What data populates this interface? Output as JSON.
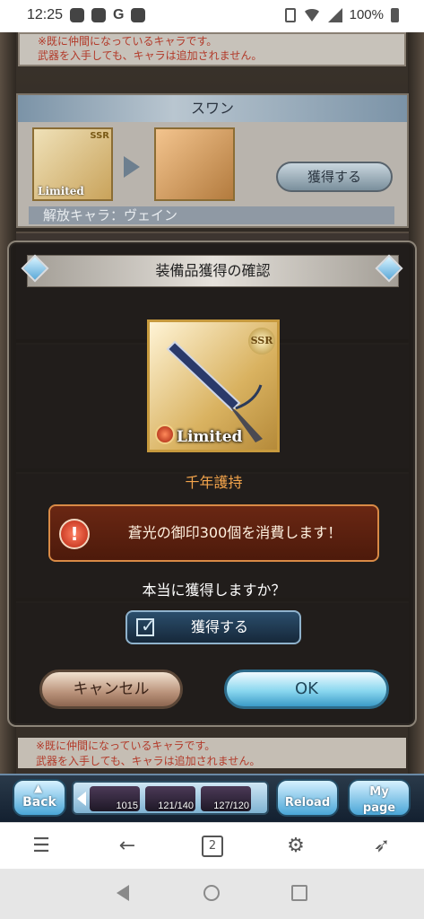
{
  "status_bar": {
    "time": "12:25",
    "battery": "100%"
  },
  "background": {
    "note_line1": "※既に仲間になっているキャラです。",
    "note_line2": "武器を入手しても、キャラは追加されません。",
    "card": {
      "title": "スワン",
      "weapon_ssr": "SSR",
      "weapon_badge": "Limited",
      "acquire_label": "獲得する",
      "unlock_label": "解放キャラ：ヴェイン"
    },
    "bottom_note_line1": "※既に仲間になっているキャラです。",
    "bottom_note_line2": "武器を入手しても、キャラは追加されません。"
  },
  "modal": {
    "title": "装備品獲得の確認",
    "item": {
      "rarity": "SSR",
      "badge": "Limited",
      "name": "千年護持"
    },
    "warning": "蒼光の御印300個を消費します！",
    "question": "本当に獲得しますか？",
    "confirm_checkbox_label": "獲得する",
    "cancel_label": "キャンセル",
    "ok_label": "OK"
  },
  "game_footer": {
    "back_label": "Back",
    "resources": [
      "1015",
      "121/140",
      "127/120"
    ],
    "reload_label": "Reload",
    "mypage_line1": "My",
    "mypage_line2": "page"
  },
  "browser_bar": {
    "tab_count": "2"
  }
}
